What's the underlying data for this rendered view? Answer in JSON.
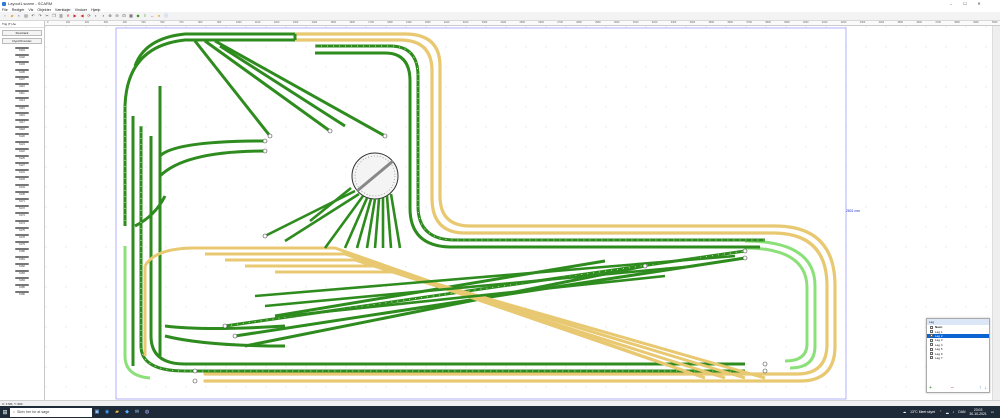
{
  "window": {
    "title": "Layout1.scarm - SCARM",
    "controls": [
      "–",
      "☐",
      "✕"
    ]
  },
  "menu": [
    "File",
    "Redigér",
    "Vis",
    "Objekter",
    "Værktøjer",
    "Vinduer",
    "Hjælp"
  ],
  "toolbar": {
    "icons": [
      "new-file-icon",
      "open-folder-icon",
      "save-icon",
      "print-icon",
      "undo-icon",
      "redo-icon",
      "cut-icon",
      "copy-icon",
      "paste-icon",
      "delete-icon",
      "arrow-right-icon",
      "arrow-left-icon",
      "rotate-icon",
      "track-icon",
      "flex-track-icon",
      "zoom-in-icon",
      "zoom-out-icon",
      "zoom-fit-icon",
      "grid-icon",
      "3d-view-icon",
      "layers-icon",
      "measure-icon",
      "help-icon",
      "info-icon"
    ]
  },
  "ruler": {
    "ticks": [
      "0",
      "100",
      "200",
      "300",
      "400",
      "500",
      "600",
      "700",
      "800",
      "900",
      "1000",
      "1100",
      "1200",
      "1300",
      "1400",
      "1500",
      "1600",
      "1700",
      "1800",
      "1900",
      "2000",
      "2100",
      "2200",
      "2300",
      "2400",
      "2500",
      "2600",
      "2700",
      "2800",
      "2900",
      "3000",
      "3100",
      "3200",
      "3300",
      "3400",
      "3500",
      "3600",
      "3700",
      "3800",
      "3900",
      "4000",
      "4100",
      "4200",
      "4300",
      "4400",
      "4500",
      "4600",
      "4700",
      "4800",
      "4900",
      "5000"
    ]
  },
  "library": {
    "header": "Trig (T) Ae",
    "tabs": [
      "Flexitrack",
      "Flyet/Omroder"
    ],
    "items": [
      "6101",
      "6102",
      "6103",
      "6106",
      "6107",
      "6110",
      "6111",
      "6114",
      "6115",
      "6116",
      "6117",
      "6118",
      "6120",
      "6121",
      "6122",
      "6125",
      "6127",
      "6131",
      "6133",
      "6134",
      "6136",
      "6171",
      "6172",
      "6173",
      "6174",
      "6175",
      "6178",
      "6179",
      "6180",
      "6181",
      "6182",
      "6183",
      "6184",
      "6185",
      "6186"
    ]
  },
  "canvas": {
    "dimension_label": "2801 mm"
  },
  "layers": {
    "title": "Lag",
    "header": "Navn",
    "rows": [
      "Lag 1",
      "Lag 2",
      "Lag 3",
      "Lag 4",
      "Lag 5",
      "Lag 6",
      "Lag 7"
    ],
    "selected": "Lag 2",
    "buttons": [
      "+",
      "–",
      "↑",
      "↓"
    ]
  },
  "status": {
    "text": "X: 1720, Y: 660"
  },
  "taskbar": {
    "search_placeholder": "Skriv her for at søge",
    "weather": "13°C  Meet skyet",
    "lang": "DAN",
    "time": "23:03",
    "date": "30-10-2021"
  },
  "colors": {
    "track_green": "#2e8b1e",
    "track_yellow": "#e8c870",
    "track_light": "#8ce07a",
    "selection_blue": "#0a64d2"
  }
}
